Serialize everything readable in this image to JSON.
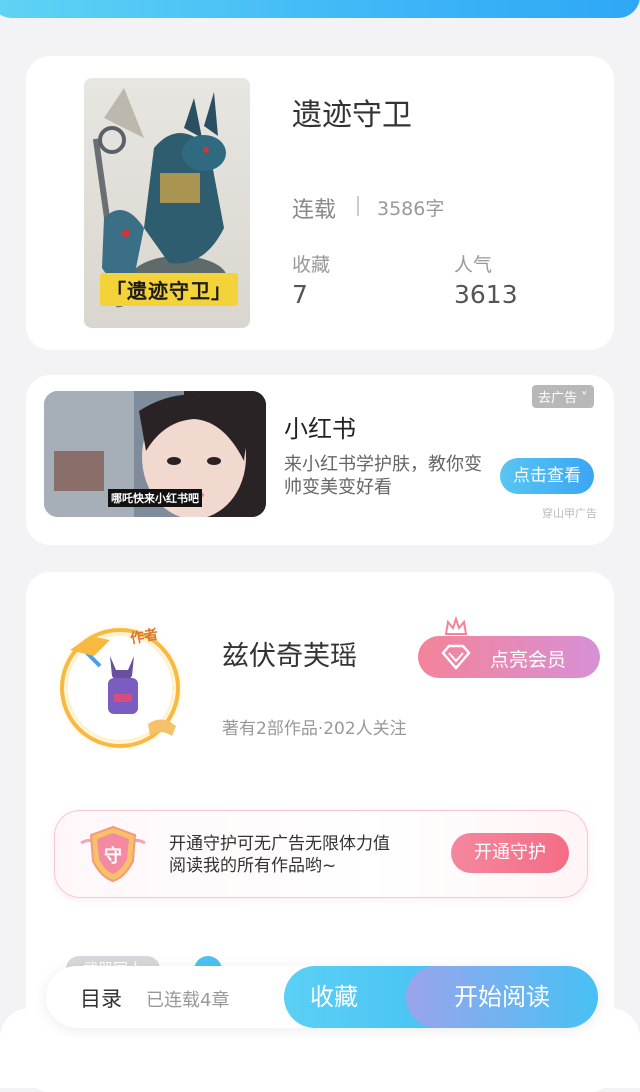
{
  "book": {
    "cover_caption": "「遗迹守卫」",
    "title": "遗迹守卫",
    "status": "连载",
    "word_count": "3586字",
    "collect_label": "收藏",
    "collect_count": "7",
    "popularity_label": "人气",
    "popularity_count": "3613"
  },
  "ad": {
    "image_caption": "哪吒快来小红书吧",
    "title": "小红书",
    "description": "来小红书学护肤，教你变帅变美变好看",
    "tag": "去广告 ˅",
    "button": "点击查看",
    "source": "穿山甲广告"
  },
  "author": {
    "badge_text": "作者",
    "name": "兹伏奇芙瑶",
    "stats": "著有2部作品·202人关注",
    "vip_button": "点亮会员",
    "guard_badge": "守",
    "guard_text_line1": "开通守护可无广告无限体力值",
    "guard_text_line2": "阅读我的所有作品哟~",
    "guard_button": "开通守护",
    "peek_chip": "武器同人"
  },
  "bottom_bar": {
    "toc": "目录",
    "chapters": "已连载4章",
    "collect": "收藏",
    "read": "开始阅读"
  },
  "colors": {
    "accent_blue": "#3fb6f7",
    "vip_pink": "#f48399",
    "guard_pink": "#f56c86"
  }
}
